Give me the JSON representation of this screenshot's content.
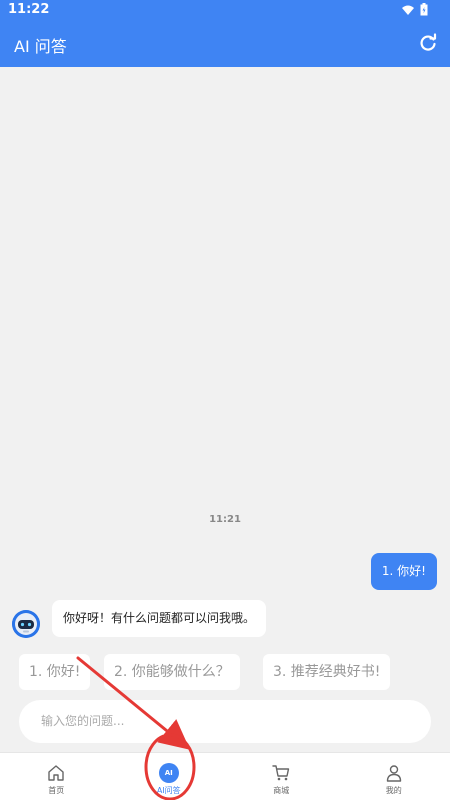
{
  "status_bar": {
    "time": "11:22",
    "icons": [
      "wifi-icon",
      "battery-icon"
    ]
  },
  "app_bar": {
    "title": "AI 问答",
    "refresh_icon": "refresh-icon"
  },
  "chat": {
    "time_label": "11:21",
    "user_message": "1. 你好!",
    "bot_message": "你好呀！有什么问题都可以问我哦。"
  },
  "suggestions": [
    "1. 你好!",
    "2. 你能够做什么？",
    "3. 推荐经典好书!"
  ],
  "input": {
    "placeholder": "输入您的问题..."
  },
  "bottom_nav": {
    "items": [
      {
        "label": "首页",
        "icon": "home-icon"
      },
      {
        "label": "AI问答",
        "icon": "ai-icon",
        "active": true
      },
      {
        "label": "商城",
        "icon": "cart-icon"
      },
      {
        "label": "我的",
        "icon": "profile-icon"
      }
    ],
    "ai_icon_text": "AI"
  },
  "colors": {
    "primary": "#3f84f3",
    "annotation": "#e53935"
  }
}
